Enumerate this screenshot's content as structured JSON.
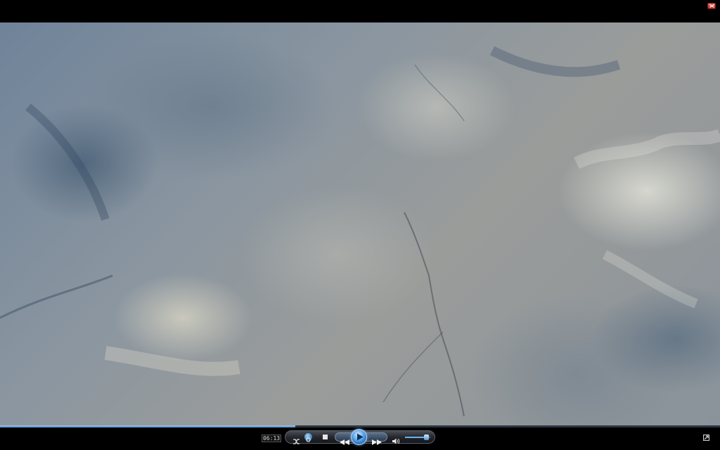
{
  "window": {
    "close_icon": "close-icon"
  },
  "video": {
    "content": "aerial-earth-video-frame"
  },
  "seek": {
    "progress_fraction": 0.41
  },
  "controls": {
    "time": "06:13",
    "shuffle_icon": "shuffle-icon",
    "repeat_icon": "repeat-icon",
    "stop_icon": "stop-icon",
    "previous_icon": "previous-icon",
    "play_icon": "play-icon",
    "next_icon": "next-icon",
    "mute_icon": "speaker-icon",
    "volume_fraction": 0.85,
    "fullscreen_icon": "fullscreen-icon"
  },
  "colors": {
    "accent": "#5aa2e6",
    "bar": "#000000"
  }
}
